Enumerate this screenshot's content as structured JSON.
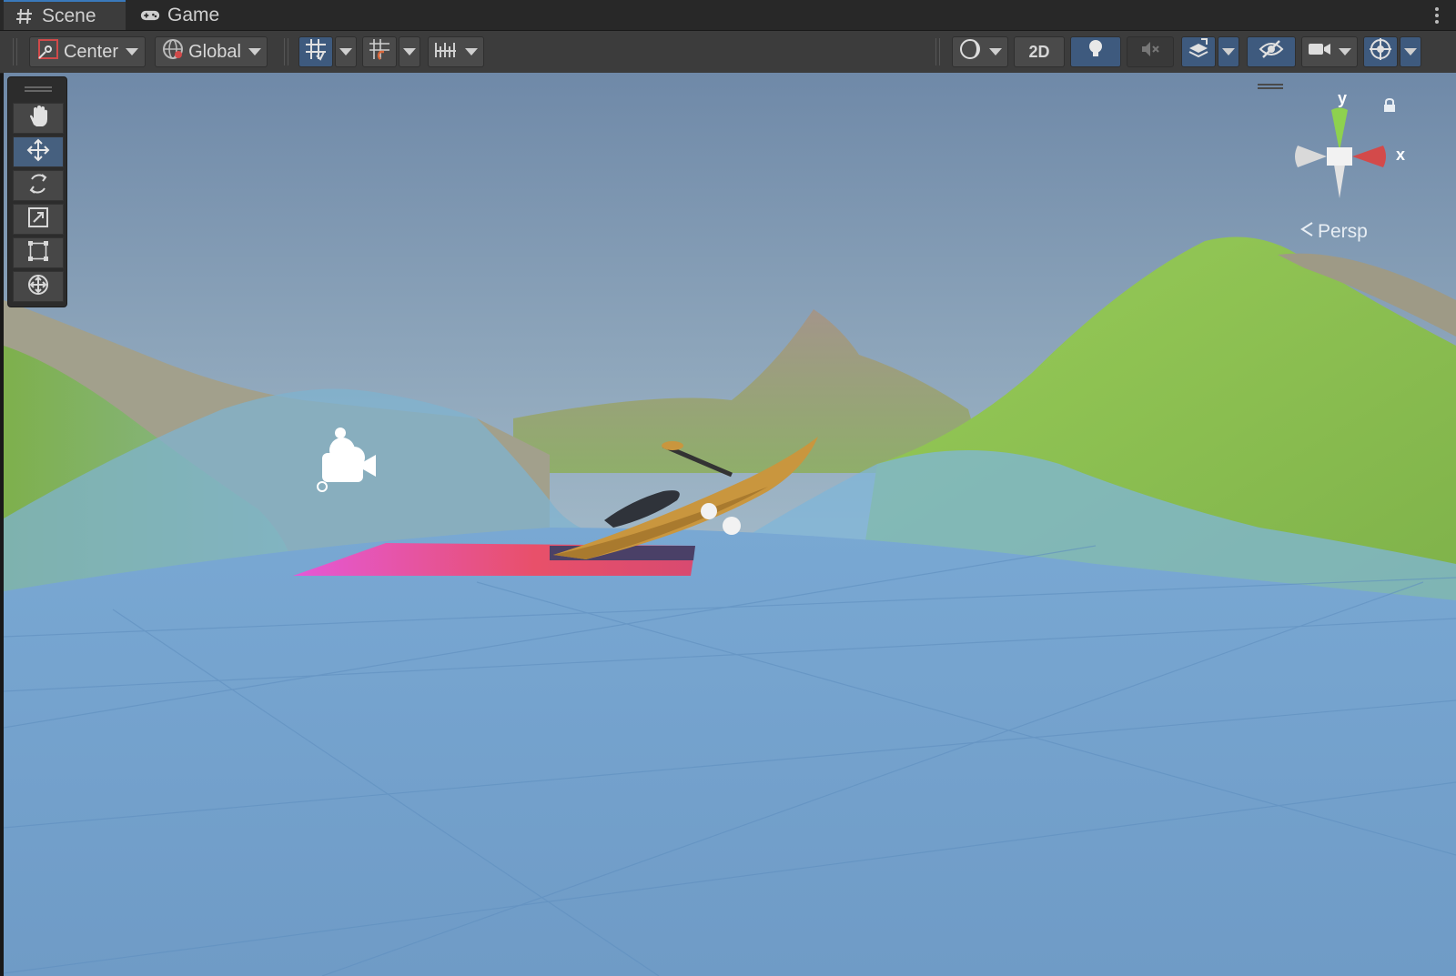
{
  "tabs": [
    {
      "label": "Scene",
      "icon": "hash-icon",
      "active": true
    },
    {
      "label": "Game",
      "icon": "gamepad-icon",
      "active": false
    }
  ],
  "toolbar": {
    "pivot_label": "Center",
    "space_label": "Global",
    "view_2d_label": "2D"
  },
  "tools": [
    {
      "name": "hand-tool",
      "icon": "hand-icon"
    },
    {
      "name": "move-tool",
      "icon": "move-icon",
      "active": true
    },
    {
      "name": "rotate-tool",
      "icon": "rotate-icon"
    },
    {
      "name": "scale-tool",
      "icon": "scale-icon"
    },
    {
      "name": "rect-tool",
      "icon": "rect-icon"
    },
    {
      "name": "transform-tool",
      "icon": "transform-icon"
    }
  ],
  "gizmo": {
    "y_label": "y",
    "x_label": "x",
    "projection_label": "Persp"
  },
  "colors": {
    "accent": "#3e5a7e",
    "sky_top": "#6e8aa8",
    "water": "#6f9fca",
    "hill_green": "#8cc04e"
  }
}
